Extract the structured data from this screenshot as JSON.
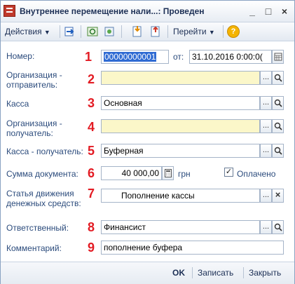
{
  "window": {
    "title": "Внутреннее перемещение нали...: Проведен",
    "minimize": "_",
    "maximize": "□",
    "close": "×"
  },
  "toolbar": {
    "actions_label": "Действия",
    "goto_label": "Перейти",
    "help_label": "?"
  },
  "form": {
    "number": {
      "label": "Номер:",
      "value": "00000000001"
    },
    "date": {
      "label": "от:",
      "value": "31.10.2016  0:00:0("
    },
    "org_sender": {
      "label_line1": "Организация -",
      "label_line2": "отправитель:",
      "value": ""
    },
    "cash": {
      "label": "Касса",
      "value": "Основная"
    },
    "org_receiver": {
      "label_line1": "Организация -",
      "label_line2": "получатель:",
      "value": ""
    },
    "cash_receiver": {
      "label": "Касса - получатель:",
      "value": "Буферная"
    },
    "amount": {
      "label": "Сумма документа:",
      "value": "40 000,00",
      "currency": "грн"
    },
    "paid": {
      "label": "Оплачено",
      "checked": true
    },
    "cashflow_item": {
      "label_line1": "Статья движения",
      "label_line2": "денежных средств:",
      "value": "Пополнение кассы"
    },
    "responsible": {
      "label": "Ответственный:",
      "value": "Финансист"
    },
    "comment": {
      "label": "Комментарий:",
      "value": "пополнение буфера"
    }
  },
  "markers": [
    "1",
    "2",
    "3",
    "4",
    "5",
    "6",
    "7",
    "8",
    "9"
  ],
  "footer": {
    "ok_label": "OK",
    "save_label": "Записать",
    "close_label": "Закрыть"
  },
  "colors": {
    "marker": "#e31b23",
    "required_bg": "#fbf7c9",
    "label": "#2b4b7c"
  }
}
